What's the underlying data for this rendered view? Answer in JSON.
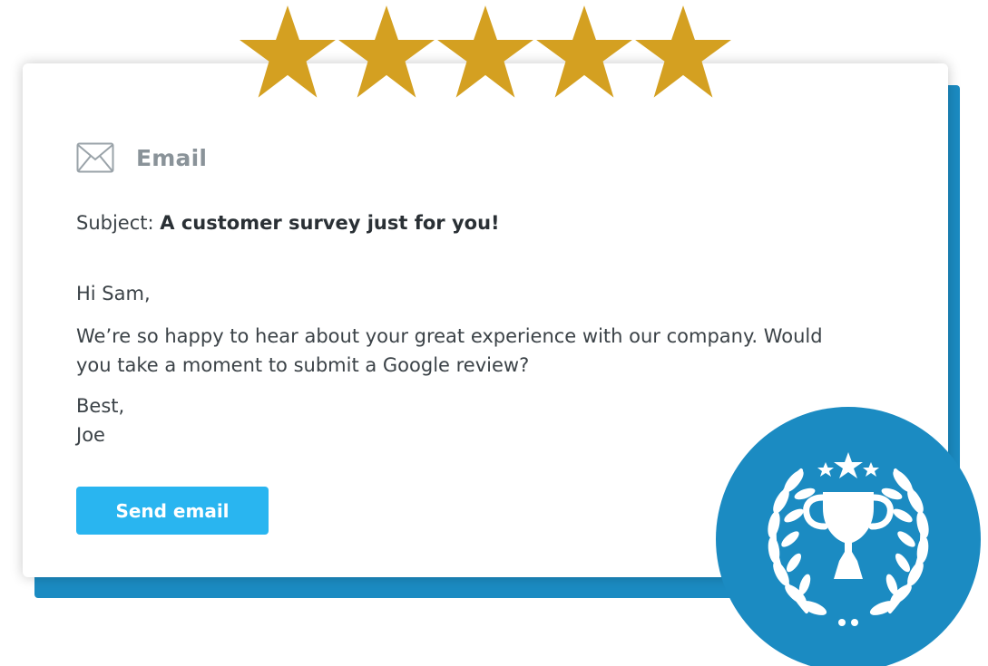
{
  "rating": {
    "value": 5,
    "max": 5,
    "star_color": "#d4a021"
  },
  "email": {
    "section_title": "Email",
    "icon": "envelope-icon",
    "subject_label": "Subject:",
    "subject_text": "A customer survey just for you!",
    "greeting": "Hi Sam,",
    "message": "We’re so happy to hear about your great experience with our company. Would you take a moment to submit a Google review?",
    "signoff_line1": "Best,",
    "signoff_line2": "Joe"
  },
  "actions": {
    "send_label": "Send email"
  },
  "badge": {
    "icon": "trophy-award-icon",
    "color": "#1b8bc2"
  },
  "colors": {
    "accent_blue": "#1b8bc2",
    "button_blue": "#29b5f0",
    "star_gold": "#d4a021",
    "muted_text": "#8a9399",
    "body_text": "#3b4247"
  }
}
